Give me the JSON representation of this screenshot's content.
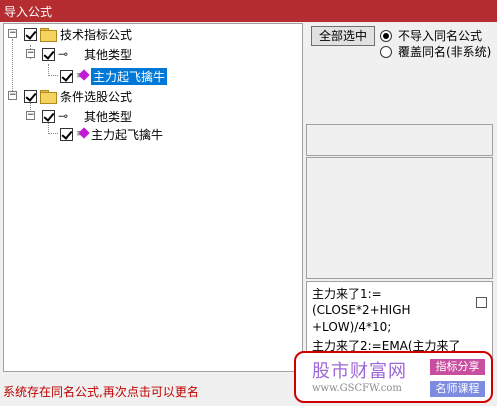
{
  "window": {
    "title": "导入公式"
  },
  "tree": {
    "nodes": [
      {
        "label": "技术指标公式",
        "type": "folder",
        "toggle": "−"
      },
      {
        "label": "其他类型",
        "type": "category",
        "toggle": "−"
      },
      {
        "label": "主力起飞擒牛",
        "type": "formula",
        "selected": true
      },
      {
        "label": "条件选股公式",
        "type": "folder",
        "toggle": "−"
      },
      {
        "label": "其他类型",
        "type": "category",
        "toggle": "−"
      },
      {
        "label": "主力起飞擒牛",
        "type": "formula",
        "selected": false
      }
    ]
  },
  "actions": {
    "select_all_label": "全部选中"
  },
  "options": {
    "no_import_label": "不导入同名公式",
    "overwrite_label": "覆盖同名(非系统)",
    "selected": "no_import"
  },
  "formula_preview": {
    "lines": [
      "主力来了1:=",
      "(CLOSE*2+HIGH",
      "+LOW)/4*10;",
      "主力来了2:=EMA(主力来了"
    ]
  },
  "status": {
    "message": "系统存在同名公式,再次点击可以更名"
  },
  "watermark": {
    "brand": "股市财富网",
    "url": "www.GSCFW.com",
    "tag1": "指标分享",
    "tag2": "名师课程"
  },
  "colors": {
    "titlebar": "#b52d30",
    "selection": "#0078d7",
    "status_text": "#c00000"
  }
}
